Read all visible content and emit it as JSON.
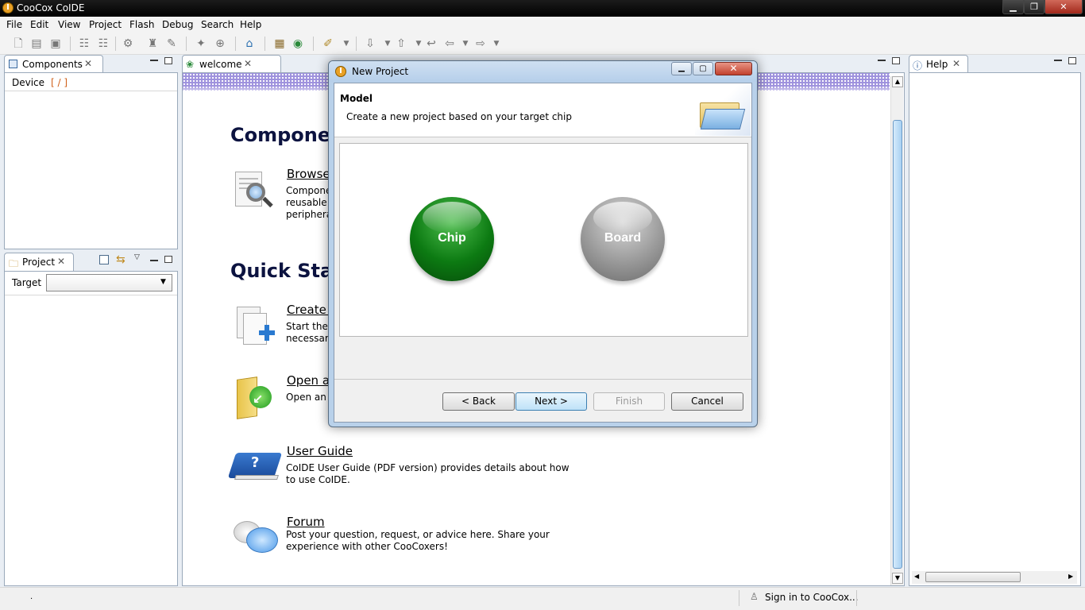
{
  "window": {
    "title": "CooCox CoIDE",
    "app_icon_letter": "I"
  },
  "menu": [
    "File",
    "Edit",
    "View",
    "Project",
    "Flash",
    "Debug",
    "Search",
    "Help"
  ],
  "components_panel": {
    "tab": "Components",
    "device_label": "Device",
    "device_value": "[ / ]"
  },
  "project_panel": {
    "tab": "Project",
    "target_label": "Target",
    "target_value": ""
  },
  "editor": {
    "tab": "welcome"
  },
  "help_panel": {
    "tab": "Help"
  },
  "welcome": {
    "heading_components": "Componen",
    "heading_quickstart": "Quick Start",
    "items": [
      {
        "link": "Browse",
        "desc1": "Compone",
        "desc2": "reusable s",
        "desc3": "peripheral"
      },
      {
        "link": "Create a",
        "desc1": "Start the w",
        "desc2": "necessary"
      },
      {
        "link": "Open a",
        "desc1": "Open an e"
      },
      {
        "link": "User Guide",
        "desc1": "CoIDE User Guide (PDF version) provides details about how",
        "desc2": "to use CoIDE."
      },
      {
        "link": "Forum",
        "desc1": "Post your question, request, or advice here. Share your",
        "desc2": "experience with other CooCoxers!"
      }
    ]
  },
  "dialog": {
    "title": "New Project",
    "section_title": "Model",
    "section_desc": "Create a new project based on your target chip",
    "options": [
      {
        "label": "Chip",
        "color": "#0c7a12"
      },
      {
        "label": "Board",
        "color": "#9a9a9a"
      }
    ],
    "buttons": {
      "back": "< Back",
      "next": "Next >",
      "finish": "Finish",
      "cancel": "Cancel"
    }
  },
  "statusbar": {
    "left": ".",
    "signin": "Sign in to CooCox..."
  },
  "colors": {
    "accent": "#3399ff",
    "heading": "#0c1340"
  }
}
